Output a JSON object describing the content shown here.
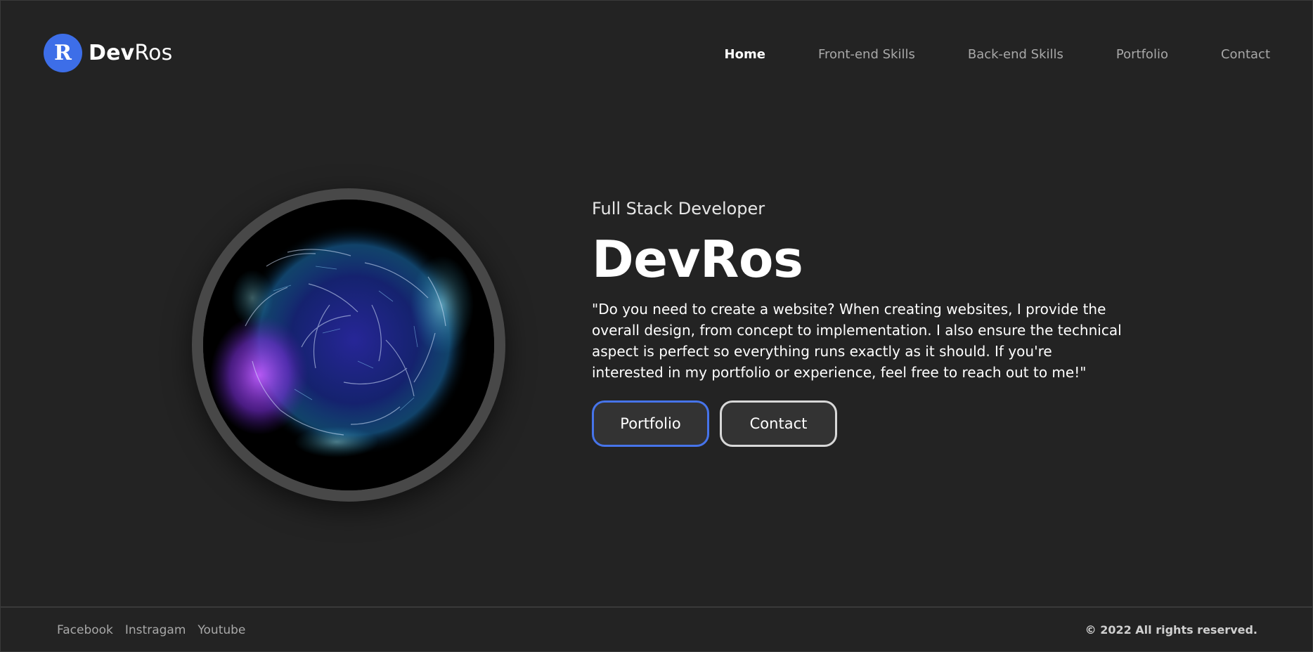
{
  "brand": {
    "badge_letter": "R",
    "name_bold": "Dev",
    "name_light": "Ros",
    "accent_color": "#3d6ee8"
  },
  "nav": {
    "items": [
      {
        "label": "Home",
        "active": true
      },
      {
        "label": "Front-end Skills",
        "active": false
      },
      {
        "label": "Back-end Skills",
        "active": false
      },
      {
        "label": "Portfolio",
        "active": false
      },
      {
        "label": "Contact",
        "active": false
      }
    ]
  },
  "hero": {
    "subtitle": "Full Stack Developer",
    "title": "DevRos",
    "description": "\"Do you need to create a website? When creating websites, I provide the overall design, from concept to implementation. I also ensure the technical aspect is perfect so everything runs exactly as it should. If you're interested in my portfolio or experience, feel free to reach out to me!\"",
    "buttons": {
      "portfolio_label": "Portfolio",
      "contact_label": "Contact"
    },
    "image_icon": "particle-globe-image"
  },
  "footer": {
    "links": [
      "Facebook",
      "Instragam",
      "Youtube"
    ],
    "copyright": "© 2022 All rights reserved."
  },
  "colors": {
    "background": "#232323",
    "portfolio_button_border": "#4674ea",
    "contact_button_border": "#d8d8d8"
  }
}
